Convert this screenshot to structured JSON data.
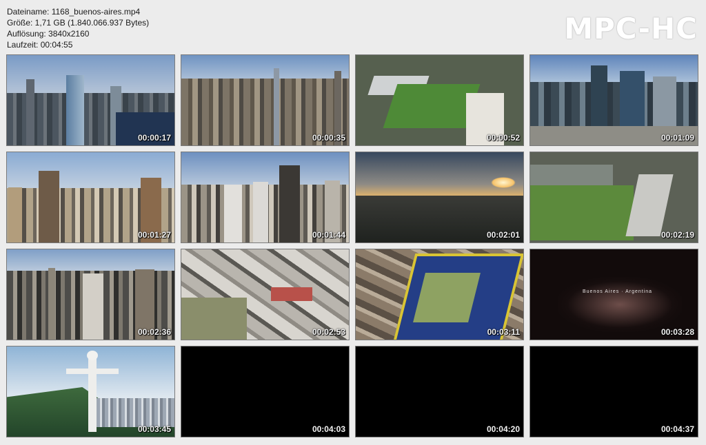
{
  "info": {
    "filename": "Dateiname: 1168_buenos-aires.mp4",
    "size": "Größe: 1,71 GB (1.840.066.937 Bytes)",
    "resolution": "Auflösung: 3840x2160",
    "duration": "Laufzeit: 00:04:55"
  },
  "logo": "MPC-HC",
  "thumbnails": [
    {
      "timestamp": "00:00:17",
      "scene": "skyline-towers"
    },
    {
      "timestamp": "00:00:35",
      "scene": "dense-city"
    },
    {
      "timestamp": "00:00:52",
      "scene": "stadium"
    },
    {
      "timestamp": "00:01:09",
      "scene": "office-towers"
    },
    {
      "timestamp": "00:01:27",
      "scene": "skyline"
    },
    {
      "timestamp": "00:01:44",
      "scene": "skyline"
    },
    {
      "timestamp": "00:02:01",
      "scene": "sunset"
    },
    {
      "timestamp": "00:02:19",
      "scene": "stadium-aerial"
    },
    {
      "timestamp": "00:02:36",
      "scene": "skyline"
    },
    {
      "timestamp": "00:02:53",
      "scene": "top-down-city"
    },
    {
      "timestamp": "00:03:11",
      "scene": "bombonera-stadium"
    },
    {
      "timestamp": "00:03:28",
      "scene": "title-card",
      "title": "Buenos Aires · Argentina",
      "subtitle": ""
    },
    {
      "timestamp": "00:03:45",
      "scene": "christ-statue"
    },
    {
      "timestamp": "00:04:03",
      "scene": "black"
    },
    {
      "timestamp": "00:04:20",
      "scene": "black"
    },
    {
      "timestamp": "00:04:37",
      "scene": "black"
    }
  ]
}
